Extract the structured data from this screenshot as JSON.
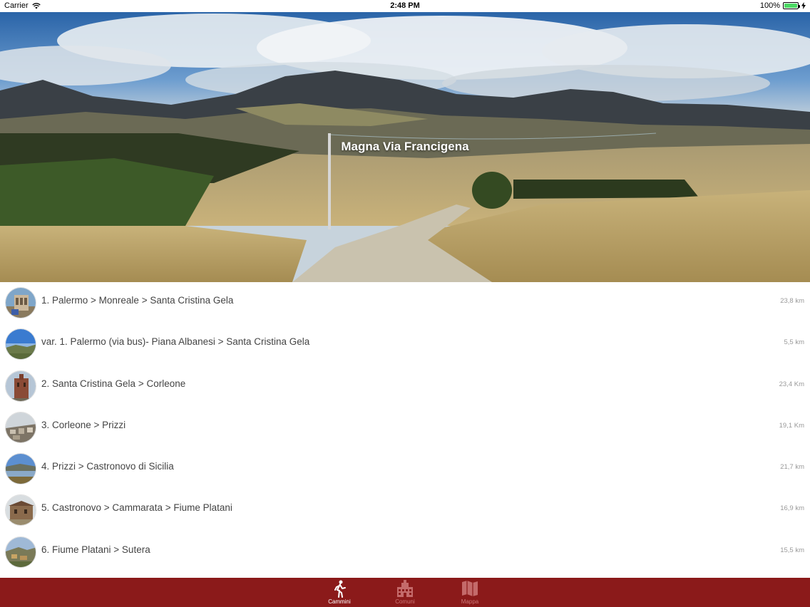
{
  "status_bar": {
    "carrier": "Carrier",
    "time": "2:48 PM",
    "battery": "100%",
    "battery_level": 1.0
  },
  "hero": {
    "title": "Magna Via Francigena"
  },
  "routes": [
    {
      "name": "1. Palermo > Monreale > Santa Cristina Gela",
      "distance": "23,8 km",
      "thumb": "church"
    },
    {
      "name": "var. 1. Palermo (via bus)- Piana Albanesi > Santa Cristina Gela",
      "distance": "5,5 km",
      "thumb": "landscape"
    },
    {
      "name": "2. Santa Cristina Gela > Corleone",
      "distance": "23,4 Km",
      "thumb": "tower"
    },
    {
      "name": "3. Corleone > Prizzi",
      "distance": "19,1 Km",
      "thumb": "town"
    },
    {
      "name": "4. Prizzi > Castronovo di Sicilia",
      "distance": "21,7 km",
      "thumb": "lake"
    },
    {
      "name": "5. Castronovo > Cammarata > Fiume Platani",
      "distance": "16,9 km",
      "thumb": "farmhouse"
    },
    {
      "name": "6. Fiume Platani > Sutera",
      "distance": "15,5 km",
      "thumb": "hill"
    }
  ],
  "tabs": [
    {
      "label": "Cammini",
      "icon": "walker-icon",
      "active": true
    },
    {
      "label": "Comuni",
      "icon": "building-icon",
      "active": false
    },
    {
      "label": "Mappa",
      "icon": "map-icon",
      "active": false
    }
  ],
  "colors": {
    "tab_bar": "#8b1a1a",
    "battery": "#4cd964"
  }
}
